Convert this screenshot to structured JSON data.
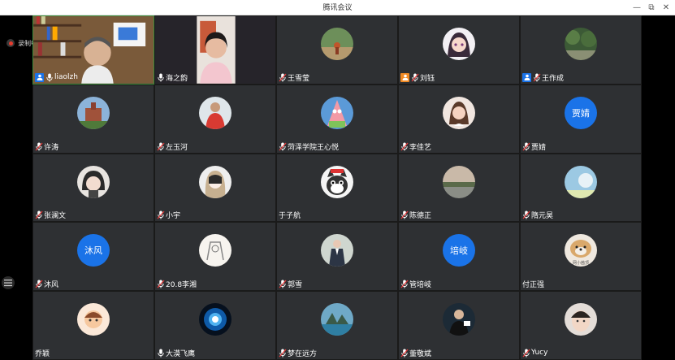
{
  "window": {
    "title": "腾讯会议"
  },
  "recording": {
    "label": "录制中",
    "color": "#e63b2e"
  },
  "colors": {
    "accent": "#1a73e8",
    "host_badge": "#1a73e8",
    "cohost_badge": "#f08a24",
    "tile_bg": "#2e3033",
    "active_border": "#3a8c3a"
  },
  "participants": [
    {
      "name": "liaolzh",
      "avatar": "video-bookshelf",
      "mic": "unmuted",
      "badge": "host-icon",
      "active": true
    },
    {
      "name": "海之韵",
      "avatar": "video-woman",
      "mic": "unmuted"
    },
    {
      "name": "王雪莹",
      "avatar": "photo-road",
      "mic": "muted"
    },
    {
      "name": "刘钰",
      "avatar": "anime-girl",
      "mic": "muted",
      "badge": "cohost-icon"
    },
    {
      "name": "王作成",
      "avatar": "photo-forest",
      "mic": "muted",
      "badge": "host-icon"
    },
    {
      "name": "许涛",
      "avatar": "photo-castle",
      "mic": "muted"
    },
    {
      "name": "左玉河",
      "avatar": "photo-man-red",
      "mic": "muted"
    },
    {
      "name": "菏泽学院王心悦",
      "avatar": "cartoon-patrick",
      "mic": "muted"
    },
    {
      "name": "李佳艺",
      "avatar": "photo-girl",
      "mic": "muted"
    },
    {
      "name": "贾婧",
      "avatar": "text",
      "avatar_text": "贾婧",
      "mic": "muted"
    },
    {
      "name": "张澜文",
      "avatar": "anime-man",
      "mic": "muted"
    },
    {
      "name": "小宇",
      "avatar": "anime-hair",
      "mic": "muted"
    },
    {
      "name": "于子航",
      "avatar": "cartoon-cat",
      "mic": "none"
    },
    {
      "name": "陈德正",
      "avatar": "photo-lake",
      "mic": "muted"
    },
    {
      "name": "隋元昊",
      "avatar": "photo-sky",
      "mic": "muted"
    },
    {
      "name": "沐风",
      "avatar": "text",
      "avatar_text": "沐风",
      "mic": "muted"
    },
    {
      "name": "20.8李湘",
      "avatar": "sketch",
      "mic": "muted"
    },
    {
      "name": "郭雪",
      "avatar": "photo-uniform",
      "mic": "muted"
    },
    {
      "name": "管培岐",
      "avatar": "text",
      "avatar_text": "培岐",
      "mic": "muted"
    },
    {
      "name": "付正强",
      "avatar": "dog",
      "avatar_caption": "网小茜顶",
      "mic": "none"
    },
    {
      "name": "乔颖",
      "avatar": "cartoon-girl",
      "mic": "none"
    },
    {
      "name": "大漠飞鹰",
      "avatar": "eye-blue",
      "mic": "unmuted"
    },
    {
      "name": "梦在远方",
      "avatar": "photo-sea",
      "mic": "muted"
    },
    {
      "name": "董敬斌",
      "avatar": "photo-speaker",
      "mic": "muted"
    },
    {
      "name": "Yucy",
      "avatar": "photo-face",
      "mic": "muted"
    }
  ]
}
